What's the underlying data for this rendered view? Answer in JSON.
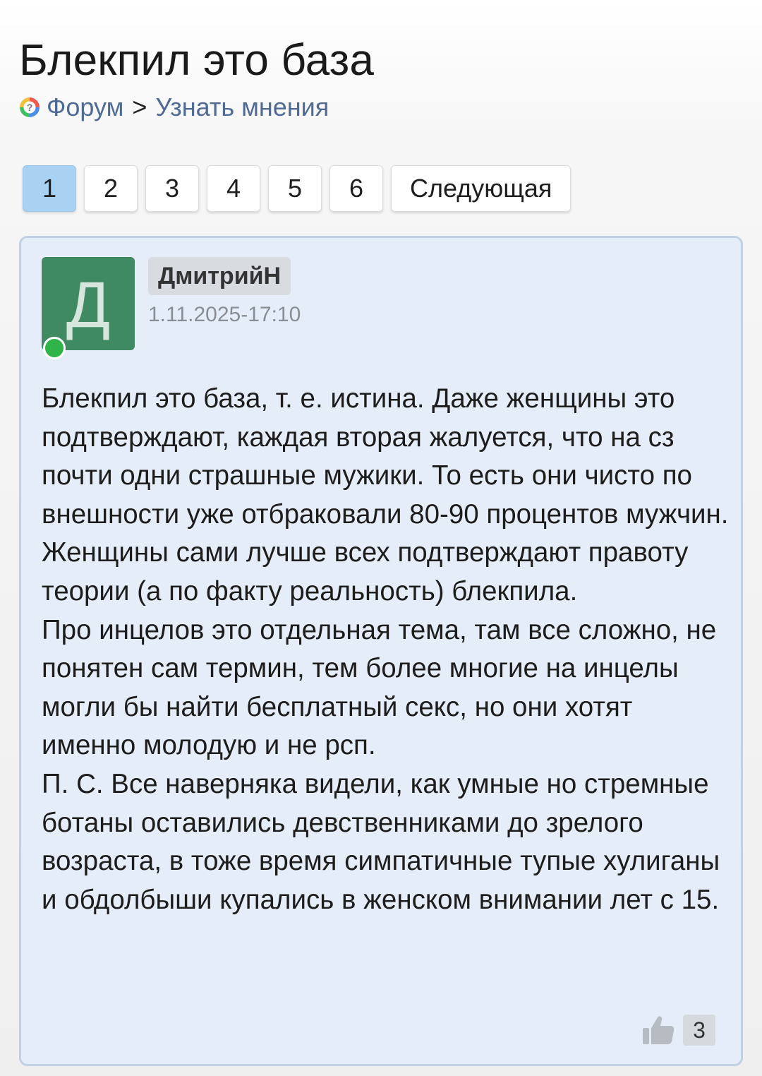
{
  "page": {
    "title": "Блекпил это база"
  },
  "breadcrumb": {
    "icon": "forum-icon",
    "items": [
      "Форум",
      "Узнать мнения"
    ],
    "separator": ">"
  },
  "pagination": {
    "pages": [
      "1",
      "2",
      "3",
      "4",
      "5",
      "6"
    ],
    "current": "1",
    "next_label": "Следующая"
  },
  "post": {
    "avatar_letter": "Д",
    "avatar_color": "#3f8a62",
    "online": true,
    "author": "ДмитрийН",
    "date": "1.11.2025-17:10",
    "paragraphs": [
      "Блекпил это база, т. е. истина. Даже женщины это подтверждают, каждая вторая жалуется, что на сз почти одни страшные мужики. То есть они чисто по внешности уже отбраковали 80-90 процентов мужчин. Женщины сами лучше всех подтверждают правоту теории (а по факту реальность) блекпила.",
      "Про инцелов это отдельная тема, там все сложно, не понятен сам термин, тем более многие на инцелы могли бы найти бесплатный секс, но они хотят именно молодую и не рсп.",
      "П. С. Все наверняка видели, как умные но стремные ботаны оставились девственниками до зрелого возраста, в тоже время симпатичные тупые хулиганы и обдолбыши купались в женском внимании лет с 15."
    ],
    "likes_icon": "thumbs-up-icon",
    "likes": "3"
  },
  "colors": {
    "link": "#4f6a94",
    "active_page": "#a9d1f2",
    "card_background": "#e5eef8",
    "card_border": "#c1d0e3",
    "online": "#2fb44a"
  }
}
